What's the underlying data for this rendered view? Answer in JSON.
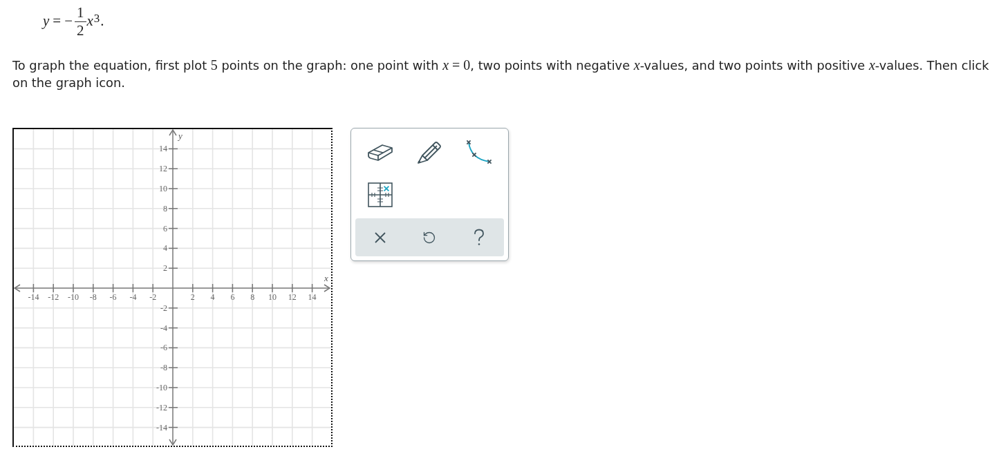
{
  "equation": {
    "lhs": "y",
    "equals": "=",
    "sign": "−",
    "numerator": "1",
    "denominator": "2",
    "variable": "x",
    "exponent": "3",
    "period": "."
  },
  "instruction": [
    {
      "kind": "text",
      "text": "To graph the equation, first plot "
    },
    {
      "kind": "math",
      "text": "5"
    },
    {
      "kind": "text",
      "text": " points on the graph: one point with "
    },
    {
      "kind": "math",
      "text": "*x* = 0"
    },
    {
      "kind": "text",
      "text": ", two points with negative "
    },
    {
      "kind": "math",
      "text": "*x*"
    },
    {
      "kind": "text",
      "text": "-values, and two points with positive "
    },
    {
      "kind": "math",
      "text": "*x*"
    },
    {
      "kind": "text",
      "text": "-values. Then click on the graph icon."
    }
  ],
  "graph": {
    "x_axis_label": "x",
    "y_axis_label": "y",
    "x_tick_labels": [
      "-14",
      "-12",
      "-10",
      "-8",
      "-6",
      "-4",
      "-2",
      "2",
      "4",
      "6",
      "8",
      "10",
      "12",
      "14"
    ],
    "y_tick_labels": [
      "14",
      "12",
      "10",
      "8",
      "6",
      "4",
      "2",
      "-2",
      "-4",
      "-6",
      "-8",
      "-10",
      "-12",
      "-14"
    ]
  },
  "tools": [
    {
      "kind": "eraser"
    },
    {
      "kind": "pencil"
    },
    {
      "kind": "curve"
    },
    {
      "kind": "point"
    }
  ],
  "actions": [
    {
      "kind": "clear"
    },
    {
      "kind": "undo"
    },
    {
      "kind": "help"
    }
  ]
}
